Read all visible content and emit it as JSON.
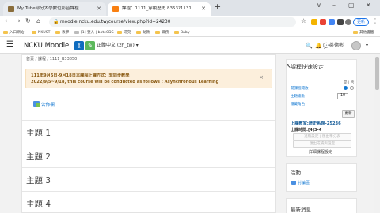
{
  "browser": {
    "tabs": [
      {
        "title": "My Tube部分大學數位影音課程...",
        "active": false,
        "favicon_color": "#8a6d3b"
      },
      {
        "title": "課程：1111_穿梭歷史 8353?1131",
        "active": true,
        "favicon_color": "#f98012"
      }
    ],
    "new_tab_label": "+",
    "window_controls": [
      "∨",
      "–",
      "▢",
      "✕"
    ],
    "url": "moodle.ncku.edu.tw/course/view.php?id=24230",
    "update_label": "更新",
    "bookmarks": [
      "入口網站",
      "NKUST",
      "教學",
      "[1] 登入 | boteCDS",
      "研究",
      "助教",
      "職務",
      "Baby"
    ],
    "bookmarks_other": "其他書籤"
  },
  "navbar": {
    "site_name": "NCKU Moodle",
    "language": "正體中文 (zh_tw) ▾",
    "username": "英德彬",
    "accent": "#0f6cbf",
    "button_green": "#5cb85c"
  },
  "breadcrumb": "首頁 / 課程 / 1111_B33850",
  "alert": {
    "line1": "111年9月5日-9月18日本課程上課方式：非同步教學",
    "line2": "2022/9/5~9/18, this course will be conducted as follows : Asynchronous Learning",
    "close": "×"
  },
  "forum_link": "公佈欄",
  "topics": [
    "主題 1",
    "主題 2",
    "主題 3",
    "主題 4"
  ],
  "quick_settings": {
    "title": "課程快速設定",
    "col_labels": "是 | 否",
    "row1_label": "開課程開放",
    "row2_label": "主題總數",
    "row2_value": "10",
    "row3_label": "隱藏角色",
    "update_button": "更新",
    "teacher": "上課教室:歷史系館-25236",
    "schedule": "上課時間:[4]3-4",
    "btn_disabled1": "進階設定 | 匯出學分表",
    "btn_disabled2": "匯出成績與設定",
    "details_link": "詳細課程設定"
  },
  "activities": {
    "title": "活動",
    "item": "討論區"
  },
  "block3_title": "最新消息"
}
